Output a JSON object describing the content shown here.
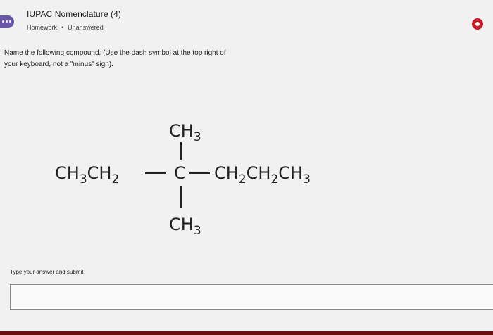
{
  "header": {
    "title": "IUPAC Nomenclature (4)",
    "category": "Homework",
    "separator": "•",
    "status": "Unanswered"
  },
  "question": {
    "text": "Name the following compound. (Use the dash symbol at the top right of your keyboard, not a \"minus\" sign)."
  },
  "structure": {
    "top_group": "CH3",
    "left_group": "CH3CH2",
    "center_atom": "C",
    "right_group": "CH2CH2CH3",
    "bottom_group": "CH3"
  },
  "answer": {
    "label": "Type your answer and submit",
    "value": "",
    "placeholder": ""
  },
  "colors": {
    "accent": "#6a56a8",
    "status_button": "#c91c2a",
    "bottom_bar": "#6b0f0f"
  },
  "icons": {
    "chat": "chat-bubble-icon",
    "status": "record-icon"
  }
}
